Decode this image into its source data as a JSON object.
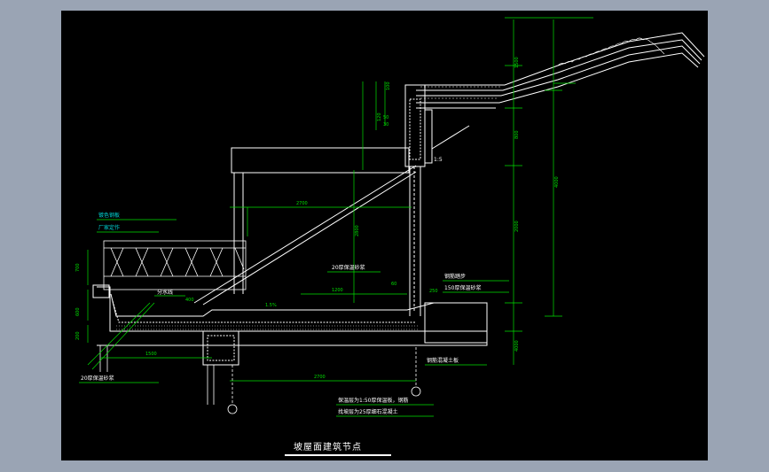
{
  "drawing": {
    "title": "坡屋面建筑节点",
    "colors": {
      "background_outer": "#9aa4b4",
      "canvas": "#000000",
      "line_white": "#ffffff",
      "line_green": "#00e000",
      "line_cyan": "#00d8d8"
    },
    "labels": {
      "l_color_steel": "镀色钢板",
      "l_factory": "厂家定作",
      "l_split_line": "分水线",
      "l_insulation_top": "20厚保温砂浆",
      "l_insulation_bottom": "20厚保温砂浆",
      "l_insulation_150": "150厚保温砂浆",
      "l_steel_step": "钢筋踏步",
      "l_concrete_slab": "钢筋混凝土板",
      "l_level": "1:5",
      "l_note1": "保温层为1:50厚保温板，钢筋",
      "l_note2": "找坡层为25厚细石混凝土"
    },
    "dimensions": {
      "d_2700_top": "2700",
      "d_2700_bottom": "2700",
      "d_1200": "1200",
      "d_1500": "1500",
      "d_400": "400",
      "d_60": "60",
      "d_250": "250",
      "d_1_5pct": "1.5%",
      "d_4000": "4000",
      "d_2000": "2000",
      "d_1500v": "1500",
      "d_800v": "800",
      "d_600v": "600",
      "d_700v": "700",
      "d_200": "200",
      "d_120": "120",
      "d_50": "50",
      "d_30": "30",
      "d_100": "100",
      "d_2800": "2800",
      "d_4000b": "4000"
    }
  }
}
